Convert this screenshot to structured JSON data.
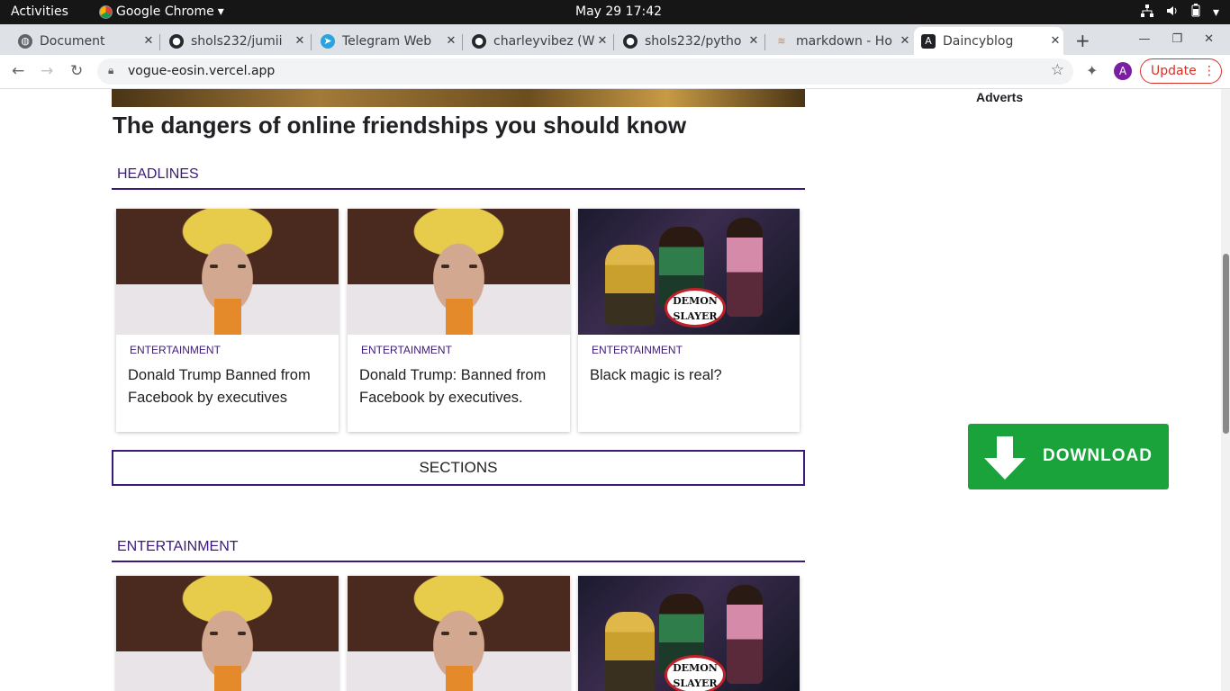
{
  "system": {
    "activities": "Activities",
    "app_name": "Google Chrome",
    "clock": "May 29  17:42"
  },
  "tabs": [
    {
      "title": "Document",
      "icon": "globe-icon"
    },
    {
      "title": "shols232/jumii",
      "icon": "github-icon"
    },
    {
      "title": "Telegram Web",
      "icon": "telegram-icon"
    },
    {
      "title": "charleyvibez (W",
      "icon": "github-icon"
    },
    {
      "title": "shols232/pytho",
      "icon": "github-icon"
    },
    {
      "title": "markdown - Ho",
      "icon": "stackoverflow-icon"
    },
    {
      "title": "Daincyblog",
      "icon": "angular-icon",
      "active": true
    }
  ],
  "toolbar": {
    "url": "vogue-eosin.vercel.app",
    "avatar_initial": "A",
    "update_label": "Update"
  },
  "page": {
    "title": "The dangers of online friendships you should know",
    "headlines_label": "HEADLINES",
    "sections_label": "SECTIONS",
    "entertainment_label": "ENTERTAINMENT",
    "adverts_label": "Adverts",
    "download_label": "DOWNLOAD",
    "headline_cards": [
      {
        "category": "ENTERTAINMENT",
        "headline": "Donald Trump Banned from Facebook by executives",
        "image": "face"
      },
      {
        "category": "ENTERTAINMENT",
        "headline": "Donald Trump: Banned from Facebook by executives.",
        "image": "face"
      },
      {
        "category": "ENTERTAINMENT",
        "headline": "Black magic is real?",
        "image": "anime"
      }
    ],
    "anime_logo": "DEMON SLAYER",
    "colors": {
      "accent": "#3b1a7a",
      "download": "#1aa33b",
      "update": "#d93025"
    }
  }
}
